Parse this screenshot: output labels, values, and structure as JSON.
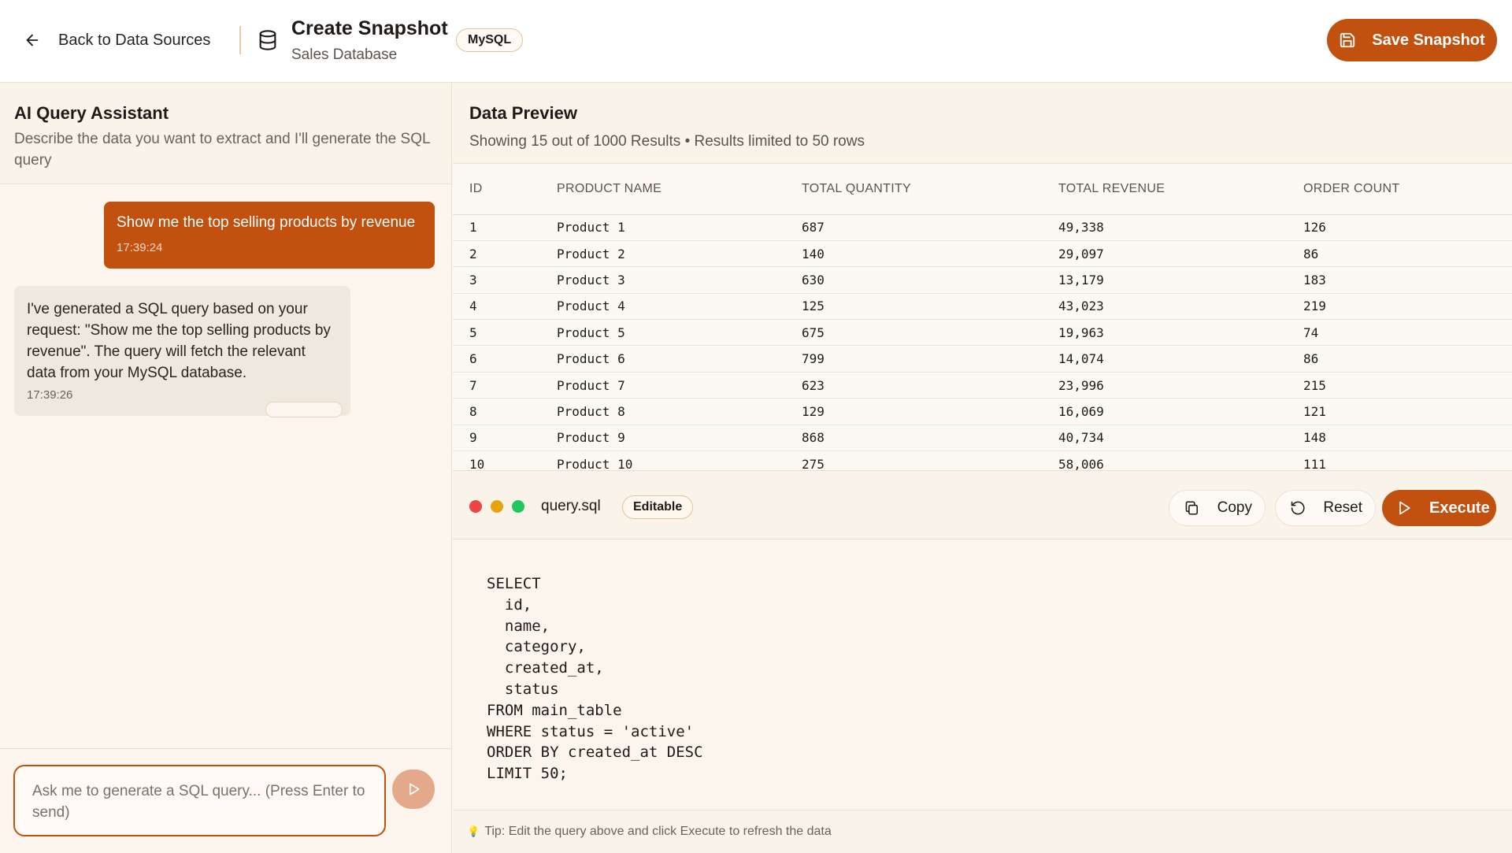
{
  "header": {
    "back_label": "Back to Data Sources",
    "title": "Create Snapshot",
    "subtitle": "Sales Database",
    "db_badge": "MySQL",
    "save_label": "Save Snapshot"
  },
  "assistant": {
    "title": "AI Query Assistant",
    "description": "Describe the data you want to extract and I'll generate the SQL query",
    "messages": [
      {
        "role": "user",
        "text": "Show me the top selling products by revenue",
        "time": "17:39:24"
      },
      {
        "role": "assistant",
        "text": "I've generated a SQL query based on your request: \"Show me the top selling products by revenue\". The query will fetch the relevant data from your MySQL database.",
        "time": "17:39:26"
      }
    ],
    "input_placeholder": "Ask me to generate a SQL query... (Press Enter to send)"
  },
  "preview": {
    "title": "Data Preview",
    "subtitle": "Showing 15 out of 1000 Results • Results limited to 50 rows",
    "columns": [
      "ID",
      "PRODUCT NAME",
      "TOTAL QUANTITY",
      "TOTAL REVENUE",
      "ORDER COUNT"
    ],
    "rows": [
      [
        "1",
        "Product 1",
        "687",
        "49,338",
        "126"
      ],
      [
        "2",
        "Product 2",
        "140",
        "29,097",
        "86"
      ],
      [
        "3",
        "Product 3",
        "630",
        "13,179",
        "183"
      ],
      [
        "4",
        "Product 4",
        "125",
        "43,023",
        "219"
      ],
      [
        "5",
        "Product 5",
        "675",
        "19,963",
        "74"
      ],
      [
        "6",
        "Product 6",
        "799",
        "14,074",
        "86"
      ],
      [
        "7",
        "Product 7",
        "623",
        "23,996",
        "215"
      ],
      [
        "8",
        "Product 8",
        "129",
        "16,069",
        "121"
      ],
      [
        "9",
        "Product 9",
        "868",
        "40,734",
        "148"
      ],
      [
        "10",
        "Product 10",
        "275",
        "58,006",
        "111"
      ]
    ]
  },
  "editor": {
    "filename": "query.sql",
    "badge": "Editable",
    "copy_label": "Copy",
    "reset_label": "Reset",
    "execute_label": "Execute",
    "code": "SELECT\n  id,\n  name,\n  category,\n  created_at,\n  status\nFROM main_table\nWHERE status = 'active'\nORDER BY created_at DESC\nLIMIT 50;",
    "tip": "Tip: Edit the query above and click Execute to refresh the data"
  },
  "colors": {
    "accent": "#c2500f",
    "background": "#fbf5ee",
    "border": "#eadfce"
  },
  "icons": [
    "arrow-left-icon",
    "database-icon",
    "save-icon",
    "send-icon",
    "copy-icon",
    "reset-icon",
    "play-icon",
    "lightbulb-icon"
  ]
}
